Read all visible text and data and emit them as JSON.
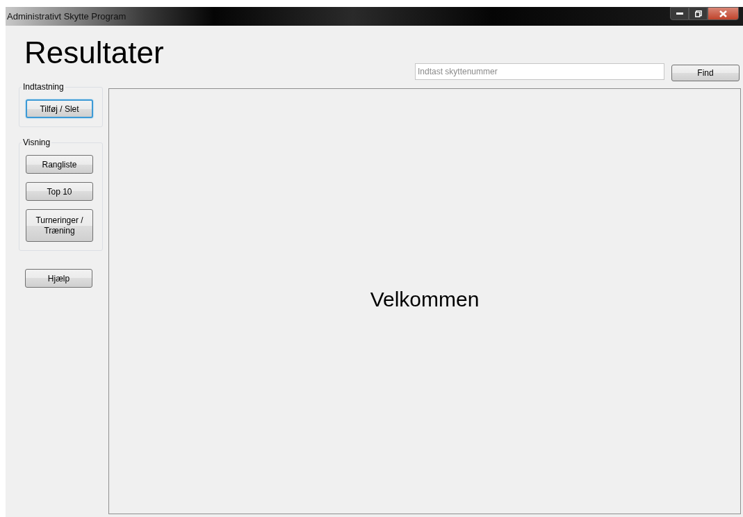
{
  "window": {
    "title": "Administrativt Skytte Program"
  },
  "heading": "Resultater",
  "search": {
    "placeholder": "Indtast skyttenummer",
    "button": "Find"
  },
  "groups": [
    {
      "title": "Indtastning",
      "buttons": [
        {
          "label": "Tilføj / Slet",
          "focused": true
        }
      ]
    },
    {
      "title": "Visning",
      "buttons": [
        {
          "label": "Rangliste",
          "focused": false
        },
        {
          "label": "Top 10",
          "focused": false
        },
        {
          "label": "Turneringer / Træning",
          "focused": false
        }
      ]
    }
  ],
  "help_button": {
    "label": "Hjælp",
    "focused": false
  },
  "main_panel": {
    "message": "Velkommen"
  }
}
